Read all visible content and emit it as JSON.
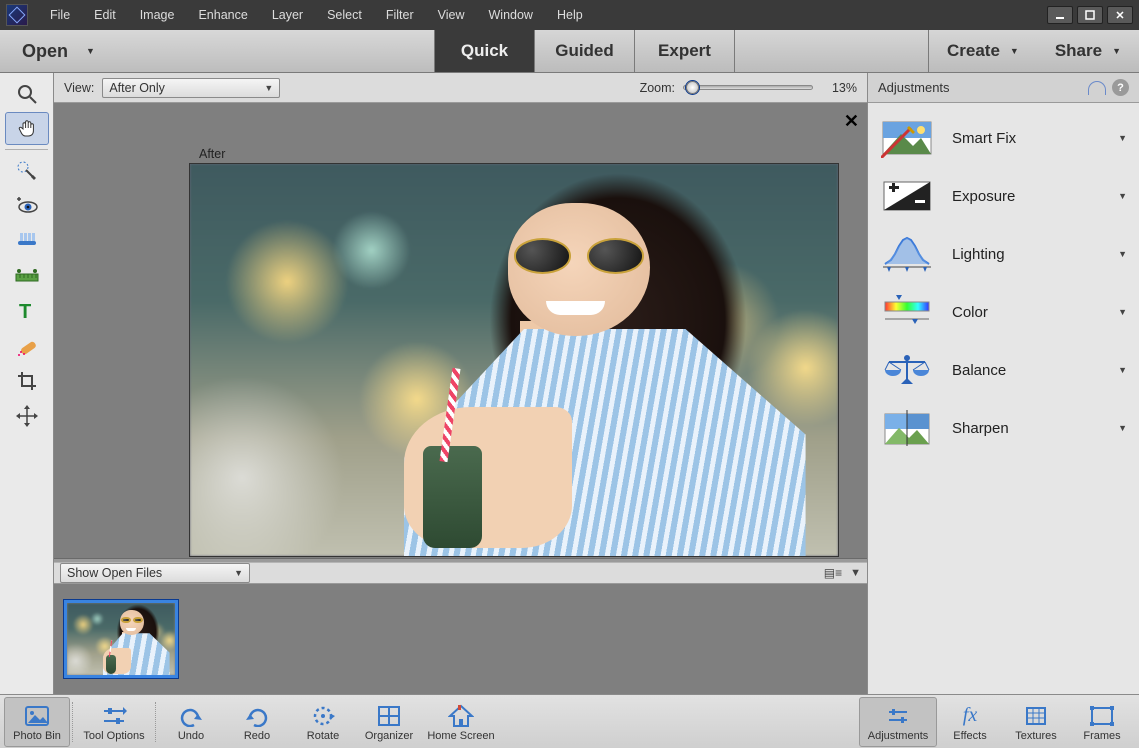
{
  "menubar": {
    "items": [
      "File",
      "Edit",
      "Image",
      "Enhance",
      "Layer",
      "Select",
      "Filter",
      "View",
      "Window",
      "Help"
    ]
  },
  "modebar": {
    "open_label": "Open",
    "modes": {
      "quick": "Quick",
      "guided": "Guided",
      "expert": "Expert"
    },
    "create_label": "Create",
    "share_label": "Share"
  },
  "viewbar": {
    "view_label": "View:",
    "view_value": "After Only",
    "zoom_label": "Zoom:",
    "zoom_value": "13%"
  },
  "canvas": {
    "after_label": "After"
  },
  "bin": {
    "dropdown": "Show Open Files"
  },
  "adjustments": {
    "title": "Adjustments",
    "items": [
      {
        "label": "Smart Fix"
      },
      {
        "label": "Exposure"
      },
      {
        "label": "Lighting"
      },
      {
        "label": "Color"
      },
      {
        "label": "Balance"
      },
      {
        "label": "Sharpen"
      }
    ]
  },
  "bottombar": {
    "photobin": "Photo Bin",
    "tooloptions": "Tool Options",
    "undo": "Undo",
    "redo": "Redo",
    "rotate": "Rotate",
    "organizer": "Organizer",
    "homescreen": "Home Screen",
    "adjustments": "Adjustments",
    "effects": "Effects",
    "textures": "Textures",
    "frames": "Frames"
  }
}
